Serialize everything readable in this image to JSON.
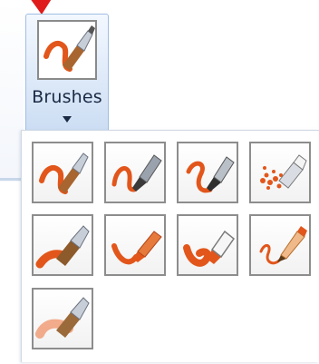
{
  "ribbon": {
    "brushes_label": "Brushes",
    "brushes_icon": "paintbrush-icon",
    "dropdown_icon": "caret-down-icon",
    "pointer_icon": "red-arrow-pointer-icon",
    "accent_color": "#e2561b"
  },
  "gallery": {
    "items": [
      {
        "id": "brush",
        "icon": "brush-icon"
      },
      {
        "id": "calligraphy-brush-1",
        "icon": "calligraphy-pen-icon"
      },
      {
        "id": "calligraphy-brush-2",
        "icon": "calligraphy-pen-icon"
      },
      {
        "id": "airbrush",
        "icon": "airbrush-icon"
      },
      {
        "id": "oil-brush",
        "icon": "oil-brush-icon"
      },
      {
        "id": "crayon",
        "icon": "crayon-icon"
      },
      {
        "id": "marker",
        "icon": "marker-icon"
      },
      {
        "id": "natural-pencil",
        "icon": "pencil-icon"
      },
      {
        "id": "watercolor-brush",
        "icon": "watercolor-brush-icon"
      }
    ]
  }
}
